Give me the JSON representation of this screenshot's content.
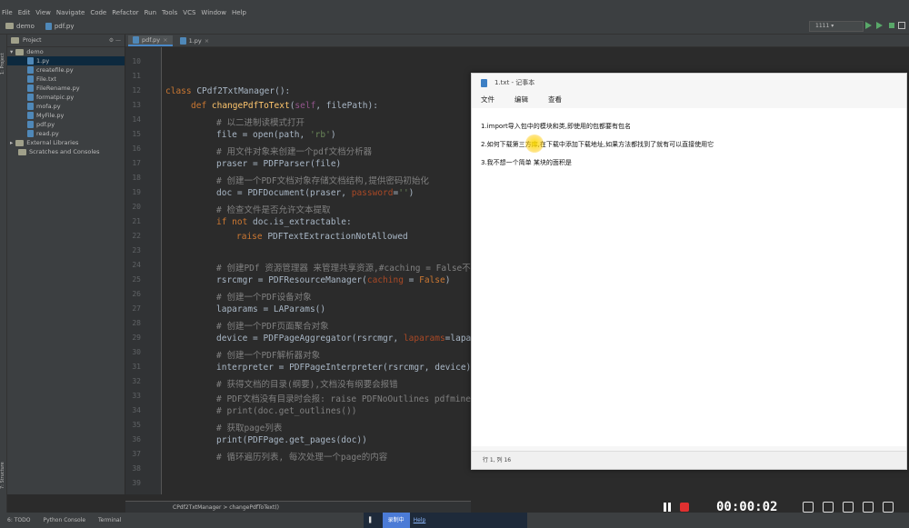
{
  "menubar": [
    "File",
    "Edit",
    "View",
    "Navigate",
    "Code",
    "Refactor",
    "Run",
    "Tools",
    "VCS",
    "Window",
    "Help"
  ],
  "navbar": {
    "project": "demo",
    "file": "pdf.py",
    "run_config": "1111"
  },
  "project_panel": {
    "header": "Project",
    "root": "demo",
    "files": [
      "1.py",
      "createfile.py",
      "File.txt",
      "FileRename.py",
      "formatpic.py",
      "mofa.py",
      "MyFile.py",
      "pdf.py",
      "read.py"
    ],
    "selected_index": 0,
    "extra": [
      "External Libraries",
      "Scratches and Consoles"
    ]
  },
  "editor_tabs": [
    {
      "label": "pdf.py",
      "active": true
    },
    {
      "label": "1.py",
      "active": false
    }
  ],
  "line_numbers": [
    "10",
    "11",
    "12",
    "13",
    "14",
    "15",
    "16",
    "17",
    "18",
    "19",
    "20",
    "21",
    "22",
    "23",
    "24",
    "25",
    "26",
    "27",
    "28",
    "29",
    "30",
    "31",
    "32",
    "33",
    "34",
    "35",
    "36",
    "37",
    "38",
    "39"
  ],
  "breadcrumb": "CPdf2TxtManager  >  changePdfToText()",
  "notepad": {
    "title": "1.txt - 记事本",
    "menu": [
      "文件",
      "编辑",
      "查看"
    ],
    "lines": [
      "1.import导入包中的模块和类,即使用的包都要有包名",
      "2.如何下载第三方库,在下载中添加下载地址,如果方法都找到了就有可以直接使用它",
      "3.我不想一个简单 某块的面积是",
      ""
    ],
    "status": "行 1, 列 16"
  },
  "recorder": {
    "time": "00:00:02"
  },
  "taskbar": {
    "btn": "录制中",
    "extra": "Help"
  },
  "bottom_tools": [
    "6: TODO",
    "Python Console",
    "Terminal"
  ]
}
